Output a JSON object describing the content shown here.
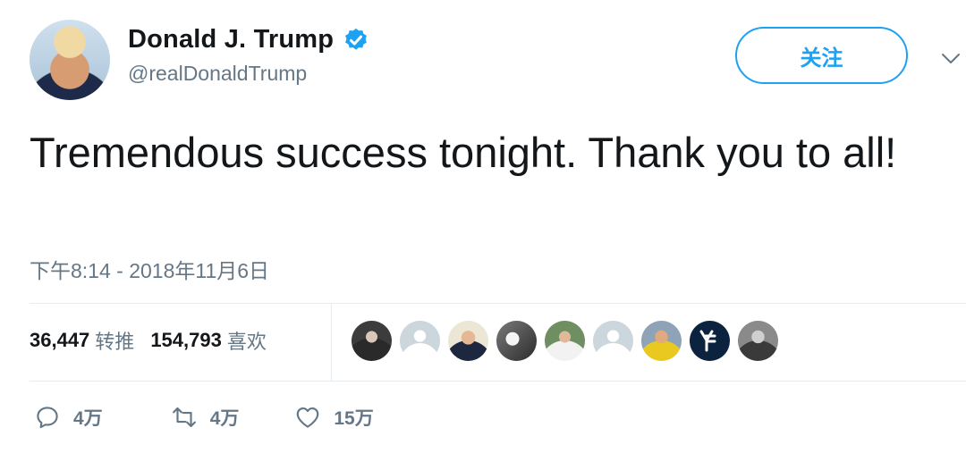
{
  "author": {
    "name": "Donald J. Trump",
    "handle": "@realDonaldTrump",
    "verified_icon": "verified-badge-icon",
    "avatar_icon": "profile-avatar"
  },
  "follow_label": "关注",
  "tweet": {
    "text": "Tremendous success tonight. Thank you to all!",
    "timestamp": "下午8:14 - 2018年11月6日"
  },
  "stats": {
    "retweets_count": "36,447",
    "retweets_label": "转推",
    "likes_count": "154,793",
    "likes_label": "喜欢"
  },
  "likers": [
    {
      "icon": "liker-avatar-1"
    },
    {
      "icon": "default-avatar"
    },
    {
      "icon": "liker-avatar-3"
    },
    {
      "icon": "liker-avatar-4"
    },
    {
      "icon": "liker-avatar-5"
    },
    {
      "icon": "default-avatar"
    },
    {
      "icon": "liker-avatar-7"
    },
    {
      "icon": "yankees-logo-avatar"
    },
    {
      "icon": "liker-avatar-9"
    }
  ],
  "actions": {
    "reply_count": "4万",
    "retweet_count": "4万",
    "like_count": "15万"
  },
  "colors": {
    "accent": "#1da1f2",
    "text": "#14171a",
    "secondary": "#657786",
    "divider": "#e6ecf0"
  }
}
